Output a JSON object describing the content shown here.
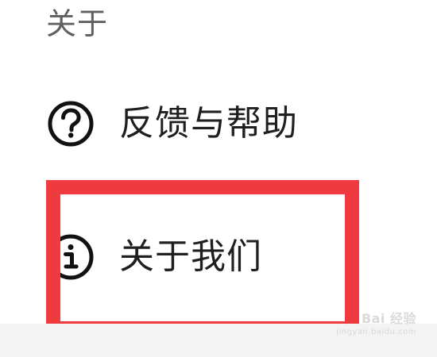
{
  "section": {
    "title": "关于"
  },
  "menu": {
    "items": [
      {
        "label": "反馈与帮助",
        "icon": "question-circle-icon"
      },
      {
        "label": "关于我们",
        "icon": "info-circle-icon"
      }
    ]
  },
  "highlight": {
    "color": "#ef3b3f"
  },
  "watermark": {
    "main": "Bai 经验",
    "sub": "jingyan.baidu.com"
  }
}
